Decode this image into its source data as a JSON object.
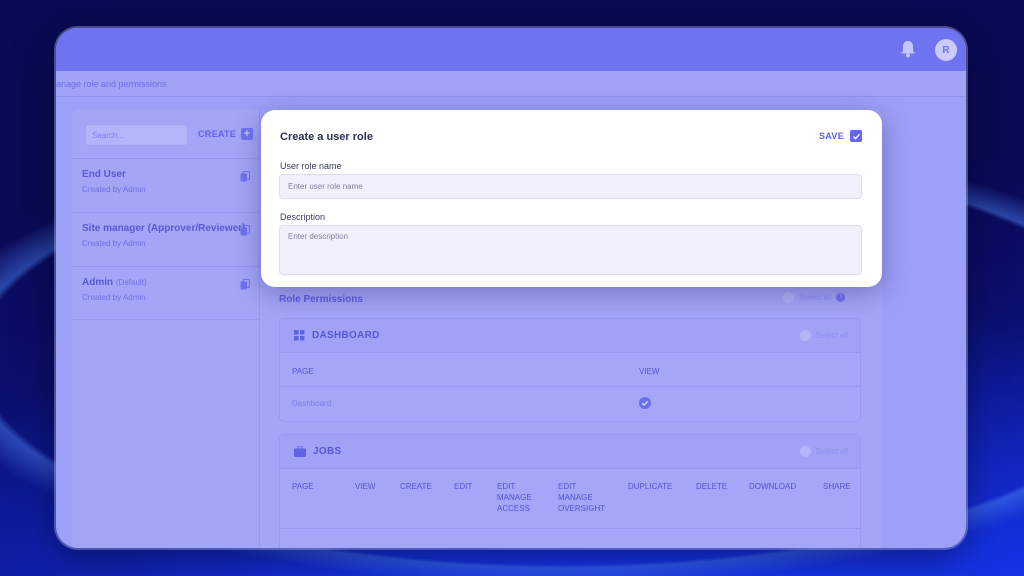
{
  "topbar": {
    "avatar_initial": "R"
  },
  "breadcrumb": "anage role and permissions",
  "sidebar": {
    "search_placeholder": "Search...",
    "create_label": "CREATE",
    "roles": [
      {
        "name": "End User",
        "tag": "",
        "meta": "Created by Admin"
      },
      {
        "name": "Site manager (Approver/Reviewer)",
        "tag": "",
        "meta": "Created by Admin"
      },
      {
        "name": "Admin",
        "tag": "(Default)",
        "meta": "Created by Admin"
      }
    ]
  },
  "permissions": {
    "title": "Role Permissions",
    "select_all": "Select all",
    "dashboard": {
      "title": "DASHBOARD",
      "select_all": "Select all",
      "columns": [
        "PAGE",
        "VIEW"
      ],
      "rows": [
        {
          "page": "Dashboard",
          "view": true
        }
      ]
    },
    "jobs": {
      "title": "JOBS",
      "select_all": "Select all",
      "columns": [
        {
          "line1": "",
          "line2": "",
          "line3": "PAGE"
        },
        {
          "line1": "",
          "line2": "",
          "line3": "VIEW"
        },
        {
          "line1": "",
          "line2": "",
          "line3": "CREATE"
        },
        {
          "line1": "",
          "line2": "",
          "line3": "EDIT"
        },
        {
          "line1": "EDIT",
          "line2": "MANAGE",
          "line3": "ACCESS"
        },
        {
          "line1": "EDIT",
          "line2": "MANAGE",
          "line3": "OVERSIGHT"
        },
        {
          "line1": "",
          "line2": "",
          "line3": "DUPLICATE"
        },
        {
          "line1": "",
          "line2": "",
          "line3": "DELETE"
        },
        {
          "line1": "",
          "line2": "",
          "line3": "DOWNLOAD"
        },
        {
          "line1": "",
          "line2": "",
          "line3": "SHARE"
        }
      ]
    }
  },
  "modal": {
    "title": "Create a user role",
    "save_label": "SAVE",
    "name_label": "User role name",
    "name_placeholder": "Enter user role name",
    "description_label": "Description",
    "description_placeholder": "Enter description"
  },
  "colors": {
    "accent": "#6366f1",
    "overlay": "#9da0f7",
    "modal_bg": "#ffffff"
  }
}
